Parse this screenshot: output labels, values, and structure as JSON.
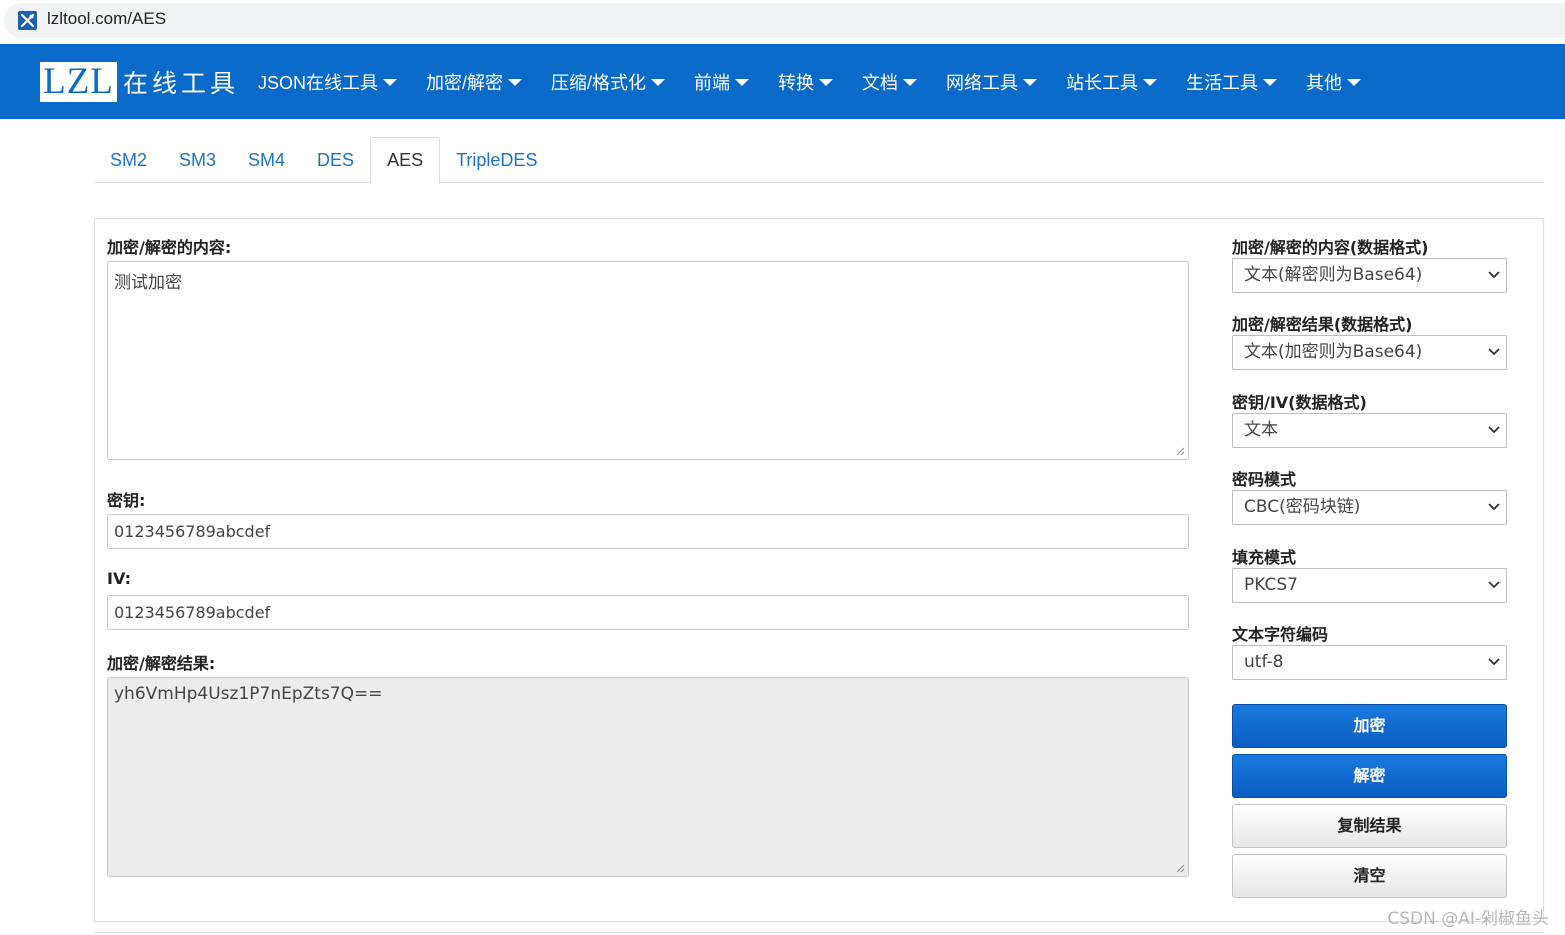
{
  "browser": {
    "url": "lzltool.com/AES",
    "favicon_icon": "tools-icon"
  },
  "navbar": {
    "logo_box": "LZL",
    "logo_text": "在线工具",
    "items": [
      {
        "label": "JSON在线工具"
      },
      {
        "label": "加密/解密"
      },
      {
        "label": "压缩/格式化"
      },
      {
        "label": "前端"
      },
      {
        "label": "转换"
      },
      {
        "label": "文档"
      },
      {
        "label": "网络工具"
      },
      {
        "label": "站长工具"
      },
      {
        "label": "生活工具"
      },
      {
        "label": "其他"
      }
    ],
    "bg_color": "#0a6ac9"
  },
  "tabs": [
    {
      "label": "SM2"
    },
    {
      "label": "SM3"
    },
    {
      "label": "SM4"
    },
    {
      "label": "DES"
    },
    {
      "label": "AES",
      "active": true
    },
    {
      "label": "TripleDES"
    }
  ],
  "form": {
    "content_label": "加密/解密的内容:",
    "content_value": "测试加密",
    "key_label": "密钥:",
    "key_value": "0123456789abcdef",
    "iv_label": "IV:",
    "iv_value": "0123456789abcdef",
    "result_label": "加密/解密结果:",
    "result_value": "yh6VmHp4Usz1P7nEpZts7Q=="
  },
  "options": {
    "content_format_label": "加密/解密的内容(数据格式)",
    "content_format_value": "文本(解密则为Base64)",
    "result_format_label": "加密/解密结果(数据格式)",
    "result_format_value": "文本(加密则为Base64)",
    "key_format_label": "密钥/IV(数据格式)",
    "key_format_value": "文本",
    "mode_label": "密码模式",
    "mode_value": "CBC(密码块链)",
    "padding_label": "填充模式",
    "padding_value": "PKCS7",
    "charset_label": "文本字符编码",
    "charset_value": "utf-8"
  },
  "buttons": {
    "encrypt": "加密",
    "decrypt": "解密",
    "copy": "复制结果",
    "clear": "清空"
  },
  "watermark": "CSDN @AI-剁椒鱼头"
}
